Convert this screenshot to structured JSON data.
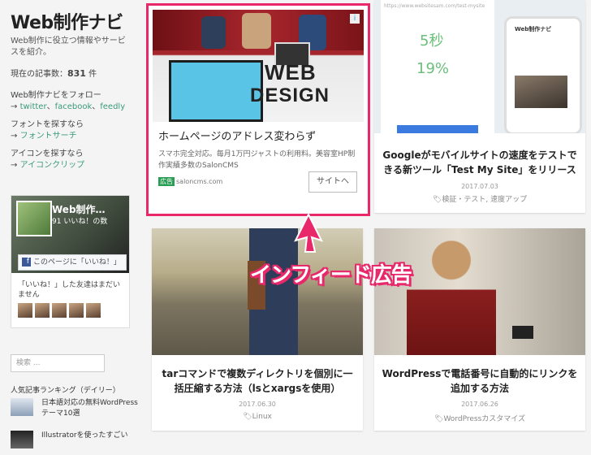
{
  "sidebar": {
    "site_title": "Web制作ナビ",
    "description": "Web制作に役立つ情報やサービスを紹介。",
    "post_count_label": "現在の記事数：",
    "post_count": "831",
    "post_count_unit": "件",
    "follow_label": "Web制作ナビをフォロー",
    "follow_links": [
      "twitter",
      "facebook",
      "feedly"
    ],
    "font_label": "フォントを探すなら",
    "font_link": "フォントサーチ",
    "icon_label": "アイコンを探すなら",
    "icon_link": "アイコンクリップ",
    "arrow": "→",
    "sep": "、",
    "facebook": {
      "page_name": "Web制作…",
      "likes": "91 いいね！の数",
      "like_button": "このページに「いいね！」",
      "friends_text": "「いいね！」した友達はまだいません"
    },
    "search_placeholder": "検索 ...",
    "ranking_title": "人気記事ランキング（デイリー）",
    "ranking": [
      {
        "title": "日本語対応の無料WordPressテーマ10選"
      },
      {
        "title": "Illustratorを使ったすごい"
      }
    ]
  },
  "ad": {
    "image_text_1": "WEB",
    "image_text_2": "DESIGN",
    "title": "ホームページのアドレス変わらず",
    "text": "スマホ完全対応。毎月1万円ジャストの利用料。美容室HP制作実績多数のSalonCMS",
    "badge": "広告",
    "domain": "saloncms.com",
    "button": "サイトへ"
  },
  "callout": "インフィード広告",
  "cards": [
    {
      "title": "Googleがモバイルサイトの速度をテストできる新ツール「Test My Site」をリリース",
      "date": "2017.07.03",
      "category": "検証・テスト, 速度アップ",
      "img_text_1": "5秒",
      "img_text_2": "19%",
      "img_url": "https://www.websitesam.com/test-mysite",
      "phone_title": "Web制作ナビ"
    },
    {
      "title": "tarコマンドで複数ディレクトリを個別に一括圧縮する方法（lsとxargsを使用）",
      "date": "2017.06.30",
      "category": "Linux"
    },
    {
      "title": "WordPressで電話番号に自動的にリンクを追加する方法",
      "date": "2017.06.26",
      "category": "WordPressカスタマイズ"
    }
  ]
}
